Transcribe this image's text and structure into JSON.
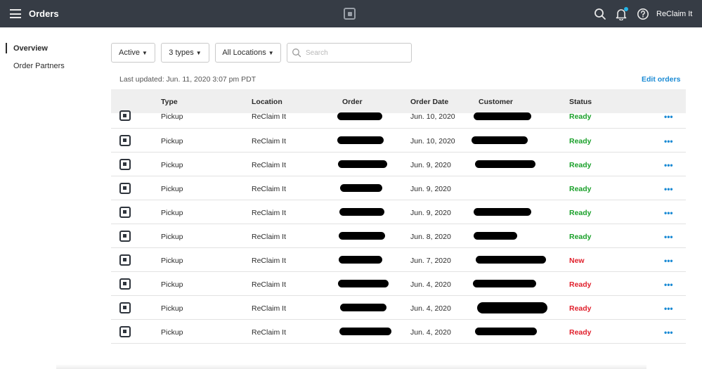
{
  "header": {
    "title": "Orders",
    "account": "ReClaim It"
  },
  "sidebar": {
    "items": [
      {
        "label": "Overview",
        "active": true
      },
      {
        "label": "Order Partners",
        "active": false
      }
    ]
  },
  "filters": {
    "status": "Active",
    "types": "3 types",
    "locations": "All Locations",
    "search_placeholder": "Search"
  },
  "last_updated": "Last updated: Jun. 11, 2020 3:07 pm PDT",
  "edit_orders": "Edit orders",
  "table": {
    "columns": [
      "Type",
      "Location",
      "Order",
      "Order Date",
      "Customer",
      "Status"
    ],
    "rows": [
      {
        "type": "Pickup",
        "location": "ReClaim It",
        "date": "Jun. 10, 2020",
        "status": "Ready"
      },
      {
        "type": "Pickup",
        "location": "ReClaim It",
        "date": "Jun. 10, 2020",
        "status": "Ready"
      },
      {
        "type": "Pickup",
        "location": "ReClaim It",
        "date": "Jun. 9, 2020",
        "status": "Ready"
      },
      {
        "type": "Pickup",
        "location": "ReClaim It",
        "date": "Jun. 9, 2020",
        "status": "Ready"
      },
      {
        "type": "Pickup",
        "location": "ReClaim It",
        "date": "Jun. 9, 2020",
        "status": "Ready"
      },
      {
        "type": "Pickup",
        "location": "ReClaim It",
        "date": "Jun. 8, 2020",
        "status": "Ready"
      },
      {
        "type": "Pickup",
        "location": "ReClaim It",
        "date": "Jun. 7, 2020",
        "status": "New"
      },
      {
        "type": "Pickup",
        "location": "ReClaim It",
        "date": "Jun. 4, 2020",
        "status": "Ready"
      },
      {
        "type": "Pickup",
        "location": "ReClaim It",
        "date": "Jun. 4, 2020",
        "status": "Ready"
      },
      {
        "type": "Pickup",
        "location": "ReClaim It",
        "date": "Jun. 4, 2020",
        "status": "Ready"
      }
    ],
    "more_label": "•••"
  },
  "colors": {
    "topbar": "#363c45",
    "ready": "#1aa02a",
    "new": "#e0202c",
    "link": "#1a8ad4"
  },
  "icons": {
    "menu": "hamburger-icon",
    "logo": "square-logo-icon",
    "search": "search-icon",
    "notifications": "bell-icon",
    "help": "help-icon",
    "row": "square-register-icon"
  }
}
